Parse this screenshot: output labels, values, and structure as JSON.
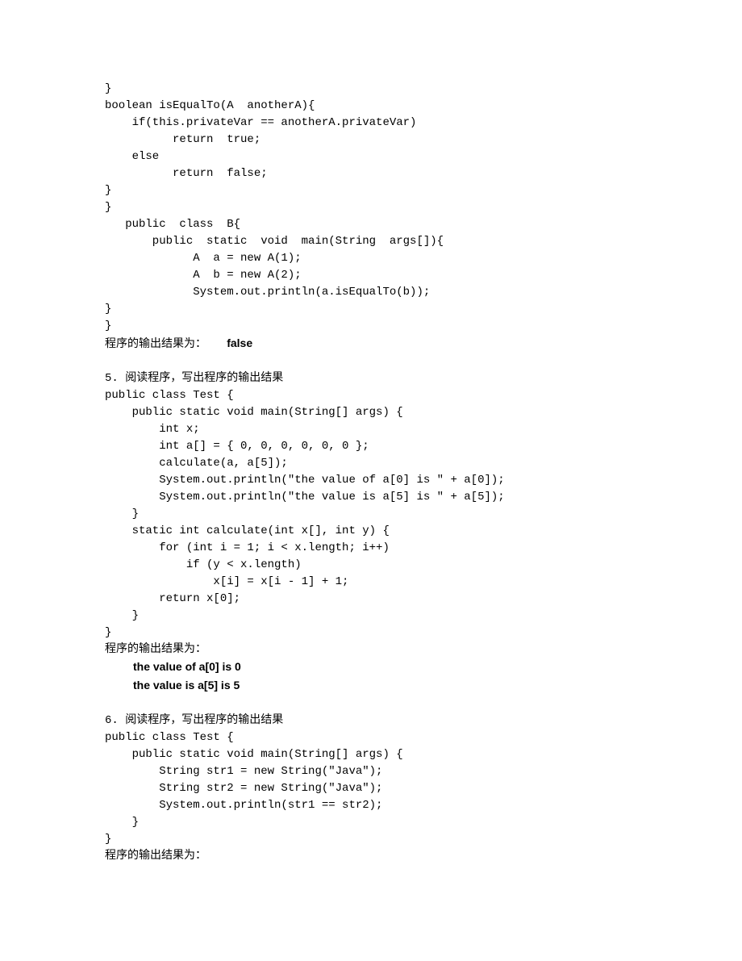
{
  "block4": {
    "lines": [
      "}",
      "boolean isEqualTo(A  anotherA){",
      "    if(this.privateVar == anotherA.privateVar)",
      "          return  true;",
      "    else",
      "          return  false;",
      "}",
      "}",
      "   public  class  B{",
      "       public  static  void  main(String  args[]){",
      "             A  a = new A(1);",
      "             A  b = new A(2);",
      "             System.out.println(a.isEqualTo(b));",
      "}",
      "}"
    ],
    "result_label": "程序的输出结果为：   ",
    "result_value": "false"
  },
  "block5": {
    "title": "5. 阅读程序，写出程序的输出结果",
    "lines": [
      "public class Test {",
      "    public static void main(String[] args) {",
      "        int x;",
      "        int a[] = { 0, 0, 0, 0, 0, 0 };",
      "        calculate(a, a[5]);",
      "        System.out.println(\"the value of a[0] is \" + a[0]);",
      "        System.out.println(\"the value is a[5] is \" + a[5]);",
      "    }",
      "",
      "    static int calculate(int x[], int y) {",
      "        for (int i = 1; i < x.length; i++)",
      "            if (y < x.length)",
      "                x[i] = x[i - 1] + 1;",
      "        return x[0];",
      "    }",
      "}"
    ],
    "result_label": "程序的输出结果为：",
    "result_line1": "the value of a[0] is 0",
    "result_line2": "the value is a[5] is 5"
  },
  "block6": {
    "title": "6. 阅读程序，写出程序的输出结果",
    "lines": [
      "public class Test {",
      "    public static void main(String[] args) {",
      "        String str1 = new String(\"Java\");",
      "        String str2 = new String(\"Java\");",
      "        System.out.println(str1 == str2);",
      "    }",
      "}"
    ],
    "result_label": "程序的输出结果为："
  }
}
